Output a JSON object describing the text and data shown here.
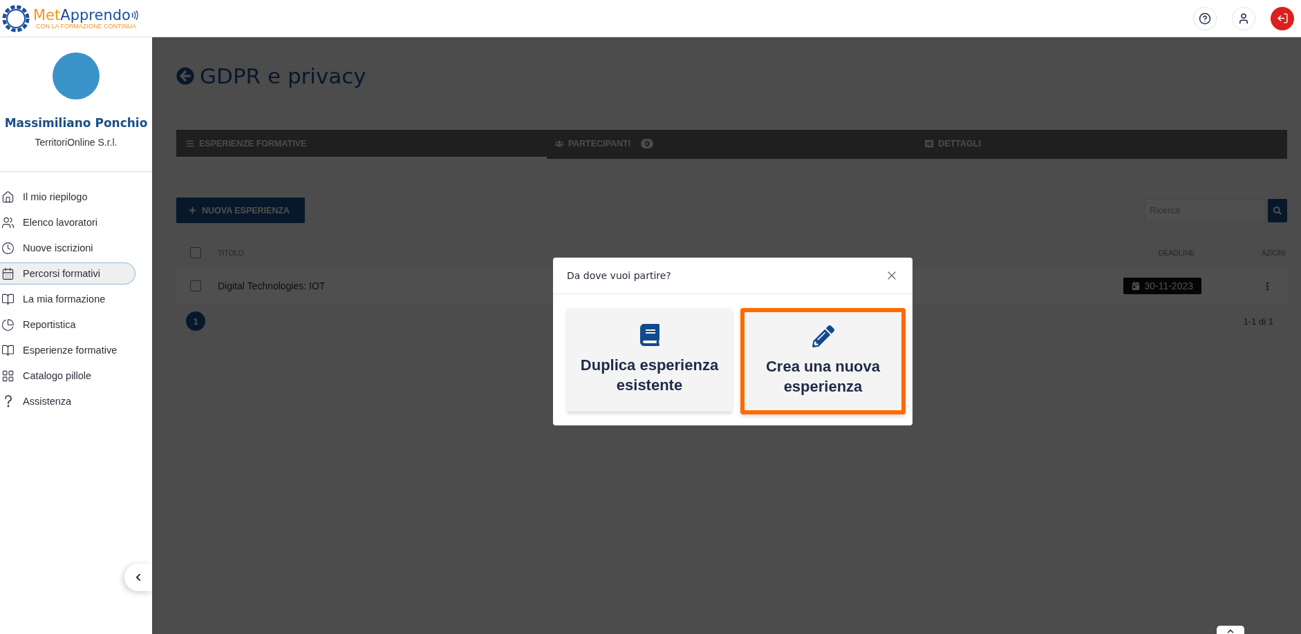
{
  "header": {
    "logo": {
      "brand_first": "Met",
      "brand_second": "Apprendo",
      "tagline": "CON LA FORMAZIONE CONTINUA"
    }
  },
  "profile": {
    "name": "Massimiliano Ponchio",
    "company": "TerritoriOnline S.r.l."
  },
  "nav": [
    {
      "label": "Il mio riepilogo",
      "selected": false
    },
    {
      "label": "Elenco lavoratori",
      "selected": false
    },
    {
      "label": "Nuove iscrizioni",
      "selected": false
    },
    {
      "label": "Percorsi formativi",
      "selected": true
    },
    {
      "label": "La mia formazione",
      "selected": false
    },
    {
      "label": "Reportistica",
      "selected": false
    },
    {
      "label": "Esperienze formative",
      "selected": false
    },
    {
      "label": "Catalogo pillole",
      "selected": false
    },
    {
      "label": "Assistenza",
      "selected": false
    }
  ],
  "page_title": "GDPR e privacy",
  "tabs": [
    {
      "label": "ESPERIENZE FORMATIVE",
      "selected": true
    },
    {
      "label": "PARTECIPANTI",
      "selected": false,
      "badge": "0"
    },
    {
      "label": "DETTAGLI",
      "selected": false
    }
  ],
  "toolbar": {
    "new_button": "NUOVA ESPERIENZA",
    "search": {
      "placeholder": "Ricerca"
    }
  },
  "table": {
    "all_checked": false,
    "columns": [
      "TITOLO",
      "DEADLINE",
      "AZIONI"
    ],
    "rows": [
      {
        "checked": false,
        "title": "Digital Technologies: IOT",
        "deadline": "30-11-2023"
      }
    ]
  },
  "pagination": {
    "pages": [
      {
        "label": "1",
        "selected": true
      }
    ],
    "summary": "1-1 di 1"
  },
  "modal": {
    "title": "Da dove vuoi partire?",
    "options": [
      {
        "label": "Duplica esperienza esistente",
        "selected": false
      },
      {
        "label": "Crea una nuova esperienza",
        "selected": true
      }
    ]
  }
}
